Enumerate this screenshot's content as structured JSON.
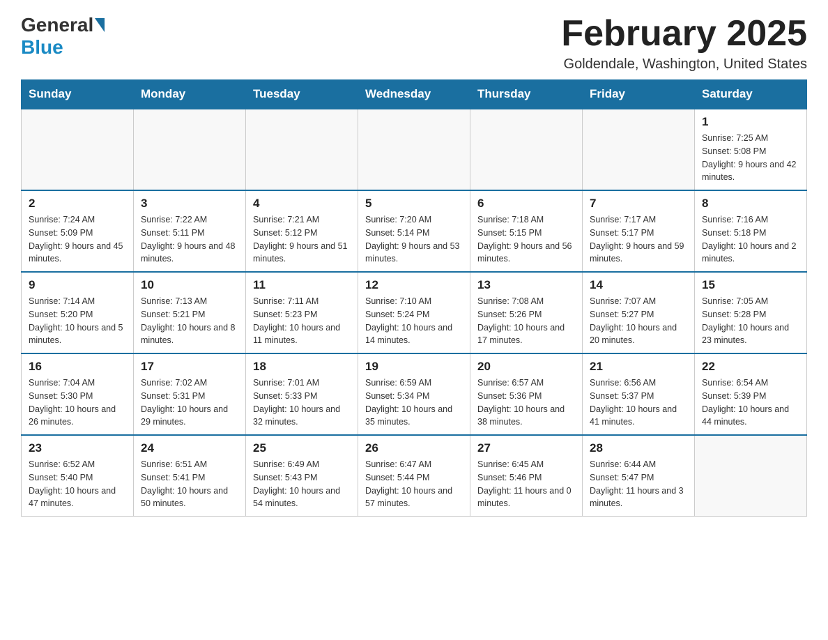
{
  "header": {
    "logo_general": "General",
    "logo_blue": "Blue",
    "month_title": "February 2025",
    "location": "Goldendale, Washington, United States"
  },
  "days_of_week": [
    "Sunday",
    "Monday",
    "Tuesday",
    "Wednesday",
    "Thursday",
    "Friday",
    "Saturday"
  ],
  "weeks": [
    [
      {
        "day": "",
        "info": ""
      },
      {
        "day": "",
        "info": ""
      },
      {
        "day": "",
        "info": ""
      },
      {
        "day": "",
        "info": ""
      },
      {
        "day": "",
        "info": ""
      },
      {
        "day": "",
        "info": ""
      },
      {
        "day": "1",
        "info": "Sunrise: 7:25 AM\nSunset: 5:08 PM\nDaylight: 9 hours and 42 minutes."
      }
    ],
    [
      {
        "day": "2",
        "info": "Sunrise: 7:24 AM\nSunset: 5:09 PM\nDaylight: 9 hours and 45 minutes."
      },
      {
        "day": "3",
        "info": "Sunrise: 7:22 AM\nSunset: 5:11 PM\nDaylight: 9 hours and 48 minutes."
      },
      {
        "day": "4",
        "info": "Sunrise: 7:21 AM\nSunset: 5:12 PM\nDaylight: 9 hours and 51 minutes."
      },
      {
        "day": "5",
        "info": "Sunrise: 7:20 AM\nSunset: 5:14 PM\nDaylight: 9 hours and 53 minutes."
      },
      {
        "day": "6",
        "info": "Sunrise: 7:18 AM\nSunset: 5:15 PM\nDaylight: 9 hours and 56 minutes."
      },
      {
        "day": "7",
        "info": "Sunrise: 7:17 AM\nSunset: 5:17 PM\nDaylight: 9 hours and 59 minutes."
      },
      {
        "day": "8",
        "info": "Sunrise: 7:16 AM\nSunset: 5:18 PM\nDaylight: 10 hours and 2 minutes."
      }
    ],
    [
      {
        "day": "9",
        "info": "Sunrise: 7:14 AM\nSunset: 5:20 PM\nDaylight: 10 hours and 5 minutes."
      },
      {
        "day": "10",
        "info": "Sunrise: 7:13 AM\nSunset: 5:21 PM\nDaylight: 10 hours and 8 minutes."
      },
      {
        "day": "11",
        "info": "Sunrise: 7:11 AM\nSunset: 5:23 PM\nDaylight: 10 hours and 11 minutes."
      },
      {
        "day": "12",
        "info": "Sunrise: 7:10 AM\nSunset: 5:24 PM\nDaylight: 10 hours and 14 minutes."
      },
      {
        "day": "13",
        "info": "Sunrise: 7:08 AM\nSunset: 5:26 PM\nDaylight: 10 hours and 17 minutes."
      },
      {
        "day": "14",
        "info": "Sunrise: 7:07 AM\nSunset: 5:27 PM\nDaylight: 10 hours and 20 minutes."
      },
      {
        "day": "15",
        "info": "Sunrise: 7:05 AM\nSunset: 5:28 PM\nDaylight: 10 hours and 23 minutes."
      }
    ],
    [
      {
        "day": "16",
        "info": "Sunrise: 7:04 AM\nSunset: 5:30 PM\nDaylight: 10 hours and 26 minutes."
      },
      {
        "day": "17",
        "info": "Sunrise: 7:02 AM\nSunset: 5:31 PM\nDaylight: 10 hours and 29 minutes."
      },
      {
        "day": "18",
        "info": "Sunrise: 7:01 AM\nSunset: 5:33 PM\nDaylight: 10 hours and 32 minutes."
      },
      {
        "day": "19",
        "info": "Sunrise: 6:59 AM\nSunset: 5:34 PM\nDaylight: 10 hours and 35 minutes."
      },
      {
        "day": "20",
        "info": "Sunrise: 6:57 AM\nSunset: 5:36 PM\nDaylight: 10 hours and 38 minutes."
      },
      {
        "day": "21",
        "info": "Sunrise: 6:56 AM\nSunset: 5:37 PM\nDaylight: 10 hours and 41 minutes."
      },
      {
        "day": "22",
        "info": "Sunrise: 6:54 AM\nSunset: 5:39 PM\nDaylight: 10 hours and 44 minutes."
      }
    ],
    [
      {
        "day": "23",
        "info": "Sunrise: 6:52 AM\nSunset: 5:40 PM\nDaylight: 10 hours and 47 minutes."
      },
      {
        "day": "24",
        "info": "Sunrise: 6:51 AM\nSunset: 5:41 PM\nDaylight: 10 hours and 50 minutes."
      },
      {
        "day": "25",
        "info": "Sunrise: 6:49 AM\nSunset: 5:43 PM\nDaylight: 10 hours and 54 minutes."
      },
      {
        "day": "26",
        "info": "Sunrise: 6:47 AM\nSunset: 5:44 PM\nDaylight: 10 hours and 57 minutes."
      },
      {
        "day": "27",
        "info": "Sunrise: 6:45 AM\nSunset: 5:46 PM\nDaylight: 11 hours and 0 minutes."
      },
      {
        "day": "28",
        "info": "Sunrise: 6:44 AM\nSunset: 5:47 PM\nDaylight: 11 hours and 3 minutes."
      },
      {
        "day": "",
        "info": ""
      }
    ]
  ]
}
